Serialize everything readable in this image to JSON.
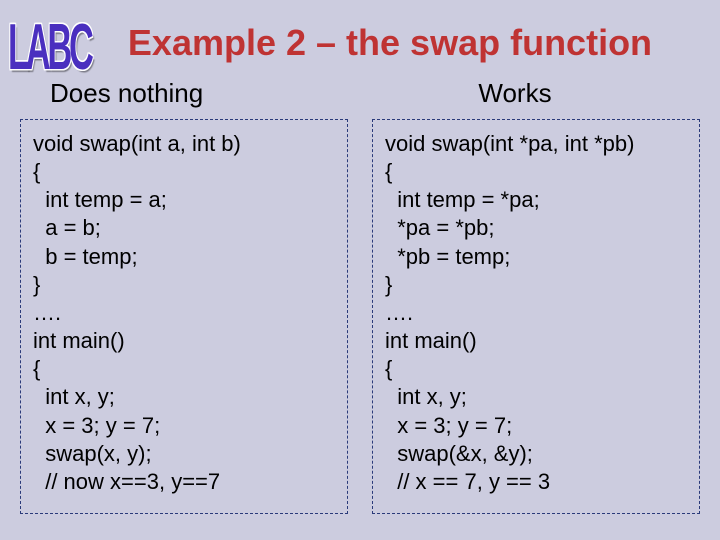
{
  "logo": "LABC",
  "title": "Example 2 – the swap function",
  "subtitles": {
    "left": "Does nothing",
    "right": "Works"
  },
  "code": {
    "left": "void swap(int a, int b)\n{\n  int temp = a;\n  a = b;\n  b = temp;\n}\n….\nint main()\n{\n  int x, y;\n  x = 3; y = 7;\n  swap(x, y);\n  // now x==3, y==7\n  ….",
    "right": "void swap(int *pa, int *pb)\n{\n  int temp = *pa;\n  *pa = *pb;\n  *pb = temp;\n}\n….\nint main()\n{\n  int x, y;\n  x = 3; y = 7;\n  swap(&x, &y);\n  // x == 7, y == 3\n  …"
  }
}
